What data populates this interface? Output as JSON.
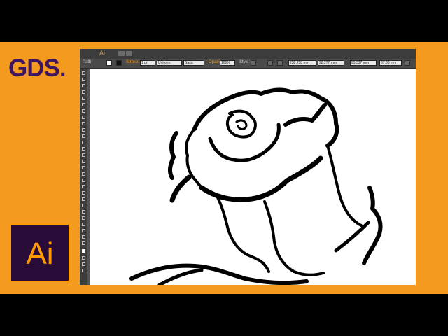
{
  "branding": {
    "gds_logo": "GDS.",
    "app_logo": "Ai"
  },
  "app": {
    "name": "Ai",
    "selection_label": "Path"
  },
  "control_bar": {
    "stroke_label": "Stroke:",
    "stroke_weight": "1 pt",
    "profile": "Uniform",
    "brush": "Basic",
    "opacity_label": "Opacity:",
    "opacity_value": "100%",
    "style_label": "Style:",
    "x_value": "238.258 mm",
    "y_value": "98.277 mm",
    "w_value": "95.537 mm",
    "h_value": "67.03 mm"
  },
  "colors": {
    "background_band": "#000000",
    "orange": "#f39a1f",
    "logo_purple": "#3e1660",
    "ai_bg": "#2a0c38",
    "ai_text": "#ff9a00",
    "ui_dark": "#535353"
  },
  "icons": {
    "tools": [
      "selection-tool",
      "direct-selection-tool",
      "magic-wand-tool",
      "lasso-tool",
      "pen-tool",
      "type-tool",
      "line-tool",
      "rectangle-tool",
      "paintbrush-tool",
      "pencil-tool",
      "blob-brush-tool",
      "eraser-tool",
      "rotate-tool",
      "scale-tool",
      "width-tool",
      "free-transform-tool",
      "shape-builder-tool",
      "perspective-grid-tool",
      "mesh-tool",
      "gradient-tool",
      "eyedropper-tool",
      "blend-tool",
      "symbol-sprayer-tool",
      "column-graph-tool",
      "artboard-tool",
      "slice-tool",
      "hand-tool",
      "zoom-tool",
      "fill-stroke-swatch",
      "swap-colors",
      "draw-mode",
      "screen-mode"
    ]
  }
}
